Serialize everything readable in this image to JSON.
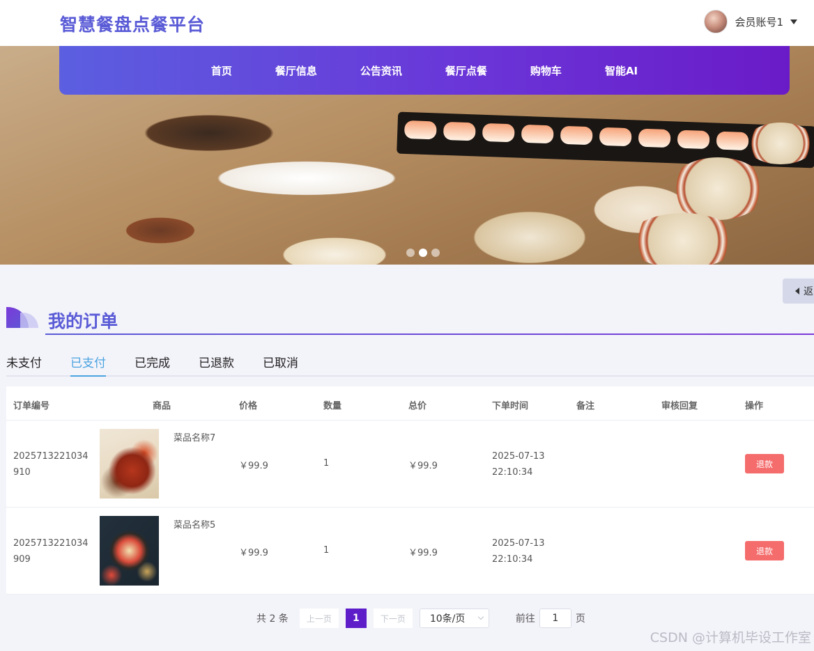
{
  "header": {
    "logo": "智慧餐盘点餐平台",
    "user_name": "会员账号1"
  },
  "nav": [
    "首页",
    "餐厅信息",
    "公告资讯",
    "餐厅点餐",
    "购物车",
    "智能AI"
  ],
  "back_label": "返",
  "page_title": "我的订单",
  "tabs": {
    "items": [
      "未支付",
      "已支付",
      "已完成",
      "已退款",
      "已取消"
    ],
    "active": "已支付"
  },
  "table": {
    "headers": [
      "订单编号",
      "商品",
      "价格",
      "数量",
      "总价",
      "下单时间",
      "备注",
      "审核回复",
      "操作"
    ],
    "rows": [
      {
        "order_no": "2025713221034910",
        "dish": "菜品名称7",
        "price": "￥99.9",
        "qty": "1",
        "total": "￥99.9",
        "time": "2025-07-13 22:10:34",
        "note": "",
        "reply": "",
        "action": "退款"
      },
      {
        "order_no": "2025713221034909",
        "dish": "菜品名称5",
        "price": "￥99.9",
        "qty": "1",
        "total": "￥99.9",
        "time": "2025-07-13 22:10:34",
        "note": "",
        "reply": "",
        "action": "退款"
      }
    ]
  },
  "pagination": {
    "total": "共 2 条",
    "prev": "上一页",
    "page": "1",
    "next": "下一页",
    "page_size": "10条/页",
    "goto_prefix": "前往",
    "goto_value": "1",
    "goto_suffix": "页"
  },
  "watermark": "CSDN @计算机毕设工作室",
  "colors": {
    "brand": "#5a5bd6",
    "nav_end": "#6a1bc8",
    "active_tab": "#4aa3e0",
    "refund": "#f56c6c",
    "pager_active": "#5d1dc9"
  }
}
